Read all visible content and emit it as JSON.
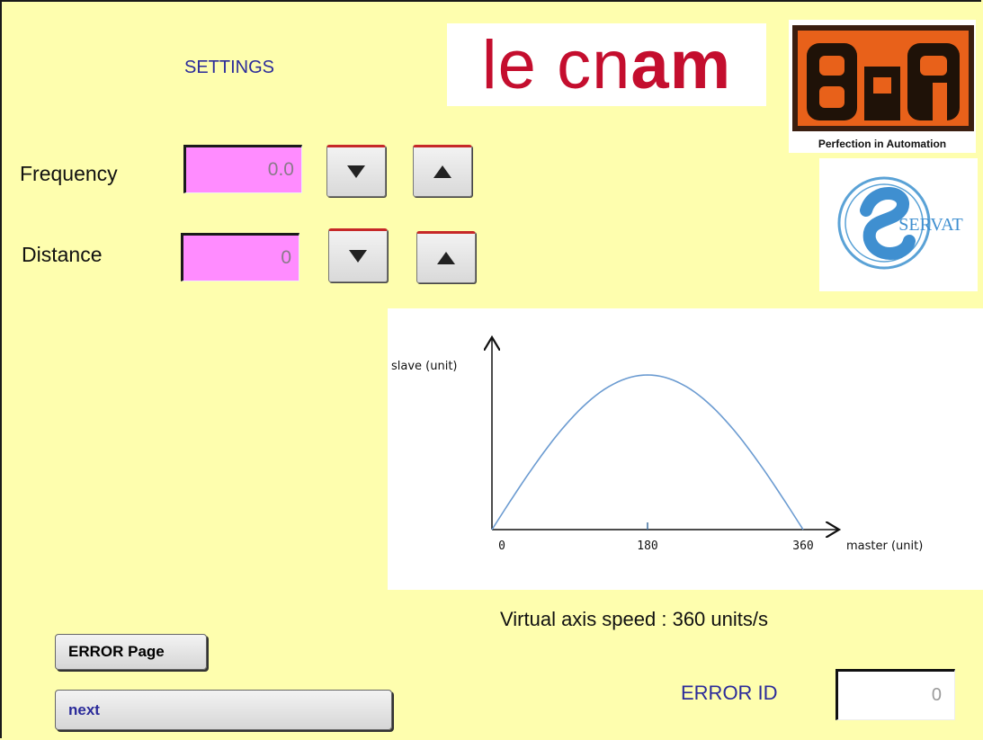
{
  "page": {
    "title": "SETTINGS"
  },
  "settings": {
    "frequency_label": "Frequency",
    "frequency_value": "0.0",
    "distance_label": "Distance",
    "distance_value": "0"
  },
  "logos": {
    "cnam_text": "le cnam",
    "br_tagline": "Perfection in Automation",
    "br_mark": "B&R",
    "servat_text": "SERVAT"
  },
  "colors": {
    "background": "#fefeae",
    "field_pink": "#ff8cff",
    "title_blue": "#2b2b9a",
    "curve_blue": "#6b9bd1",
    "cnam_red": "#c40e2e",
    "br_orange": "#e8611a"
  },
  "chart_data": {
    "type": "line",
    "xlabel": "master (unit)",
    "ylabel": "slave (unit)",
    "x_ticks": [
      "0",
      "180",
      "360"
    ],
    "xlim": [
      0,
      360
    ],
    "series": [
      {
        "x": [
          0,
          45,
          90,
          135,
          180,
          225,
          270,
          315,
          360
        ],
        "y": [
          0,
          0.383,
          0.707,
          0.924,
          1.0,
          0.924,
          0.707,
          0.383,
          0
        ]
      }
    ]
  },
  "info": {
    "speed_text": "Virtual axis speed : 360 units/s"
  },
  "buttons": {
    "error_page": "ERROR Page",
    "next": "next"
  },
  "error": {
    "label": "ERROR ID",
    "value": "0"
  }
}
